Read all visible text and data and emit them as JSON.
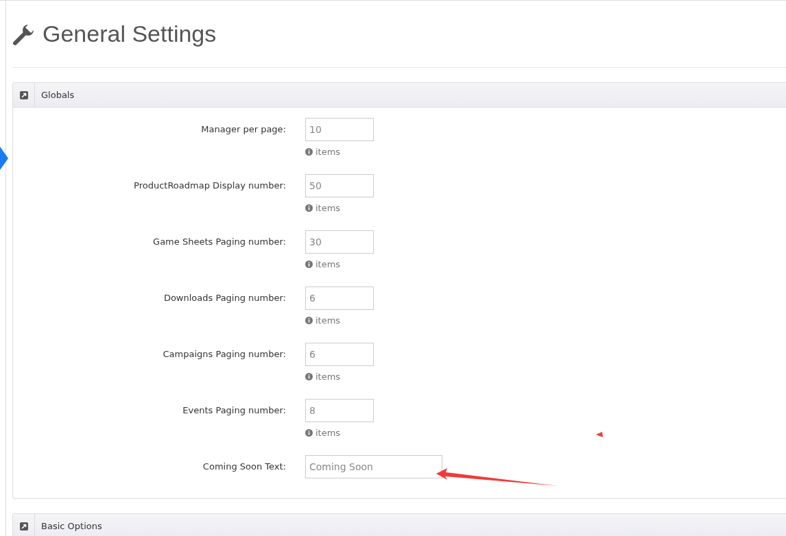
{
  "page": {
    "title": "General Settings"
  },
  "panels": [
    {
      "title": "Globals",
      "fields": [
        {
          "label": "Manager per page:",
          "value": "10",
          "help": "items",
          "kind": "number"
        },
        {
          "label": "ProductRoadmap Display number:",
          "value": "50",
          "help": "items",
          "kind": "number"
        },
        {
          "label": "Game Sheets Paging number:",
          "value": "30",
          "help": "items",
          "kind": "number"
        },
        {
          "label": "Downloads Paging number:",
          "value": "6",
          "help": "items",
          "kind": "number"
        },
        {
          "label": "Campaigns Paging number:",
          "value": "6",
          "help": "items",
          "kind": "number"
        },
        {
          "label": "Events Paging number:",
          "value": "8",
          "help": "items",
          "kind": "number"
        },
        {
          "label": "Coming Soon Text:",
          "value": "Coming Soon",
          "kind": "text"
        }
      ]
    },
    {
      "title": "Basic Options"
    }
  ]
}
